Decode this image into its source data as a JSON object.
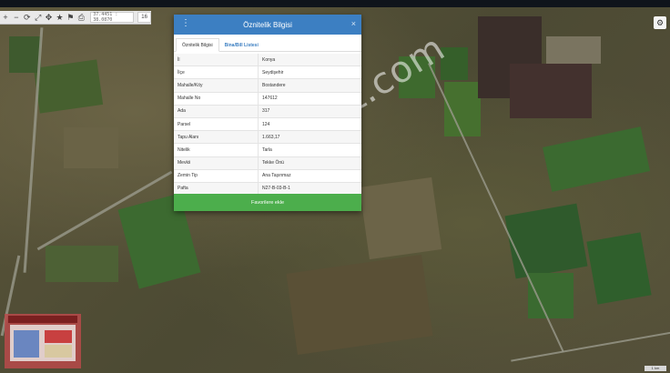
{
  "toolbar": {
    "coords": "37.4451 : 38.0870",
    "zoom": "16",
    "icons": [
      "plus-icon",
      "minus-icon",
      "refresh-icon",
      "expand-icon",
      "move-icon",
      "locate-icon",
      "star-icon",
      "print-icon"
    ]
  },
  "dialog": {
    "title": "Öznitelik Bilgisi",
    "close_label": "×",
    "menu_label": "⋮",
    "tabs": [
      {
        "label": "Öznitelik Bilgisi",
        "active": true
      },
      {
        "label": "Bina/Bill Listesi",
        "active": false
      }
    ],
    "rows": [
      {
        "key": "İl",
        "value": "Konya"
      },
      {
        "key": "İlçe",
        "value": "Seydişehir"
      },
      {
        "key": "Mahalle/Köy",
        "value": "Bostandere"
      },
      {
        "key": "Mahalle No",
        "value": "147612"
      },
      {
        "key": "Ada",
        "value": "317"
      },
      {
        "key": "Parsel",
        "value": "124"
      },
      {
        "key": "Tapu Alanı",
        "value": "1.663,17"
      },
      {
        "key": "Nitelik",
        "value": "Tarla"
      },
      {
        "key": "Mevkii",
        "value": "Tekke Önü"
      },
      {
        "key": "Zemin Tip",
        "value": "Ana Taşınmaz"
      },
      {
        "key": "Pafta",
        "value": "N27-B-03-B-1"
      }
    ],
    "favorite_button": "Favorilere ekle"
  },
  "watermark": "emlakjet.com",
  "scale_label": "1 km"
}
